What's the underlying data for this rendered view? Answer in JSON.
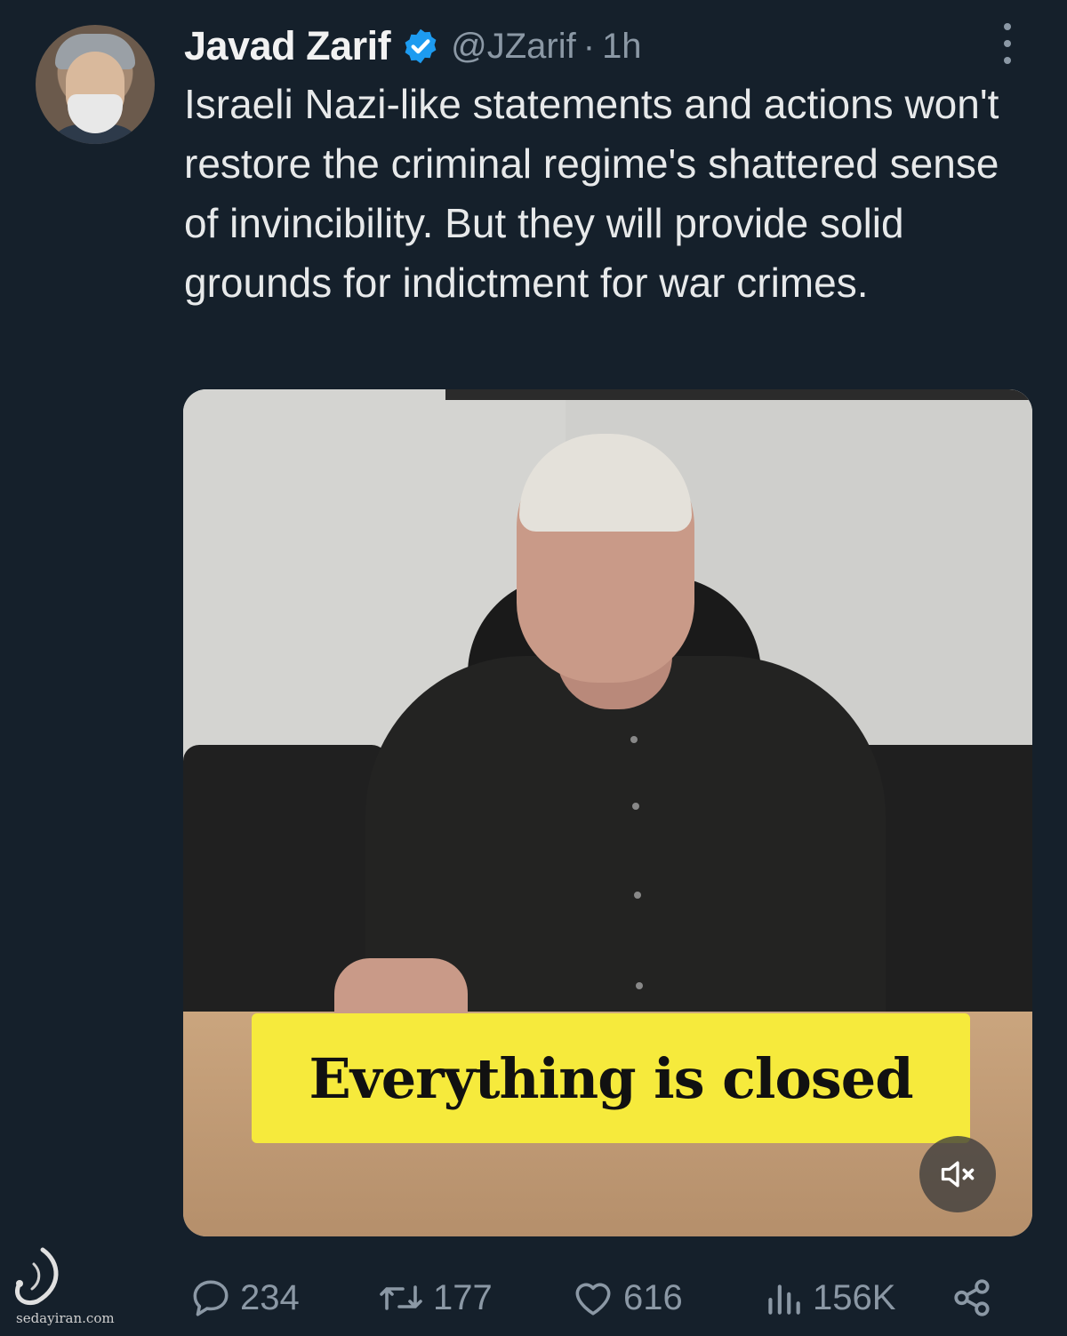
{
  "tweet": {
    "author_name": "Javad Zarif",
    "handle": "@JZarif",
    "separator": "·",
    "time": "1h",
    "text": "Israeli Nazi-like statements and actions won't restore the criminal regime's shattered sense of invincibility. But they will provide solid grounds for indictment for war crimes."
  },
  "media": {
    "caption": "Everything is closed"
  },
  "actions": {
    "replies": "234",
    "retweets": "177",
    "likes": "616",
    "views": "156K"
  },
  "watermark": {
    "text": "sedayiran.com"
  },
  "colors": {
    "background": "#15202b",
    "verified": "#1d9bf0",
    "caption_bg": "#f6ea3c",
    "muted_text": "#8b98a5"
  }
}
